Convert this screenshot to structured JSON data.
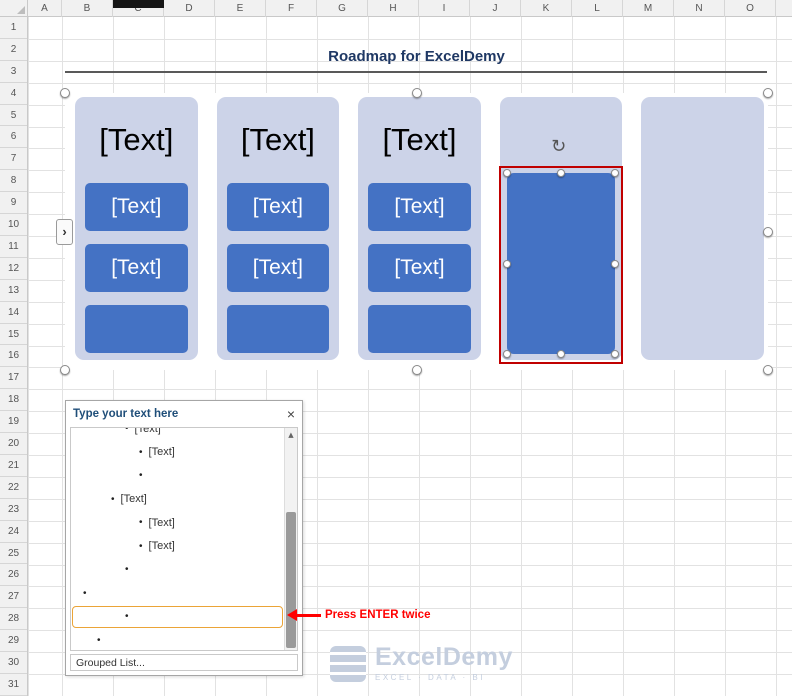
{
  "colors": {
    "accent_blue": "#4472C4",
    "column_fill": "#CCD3E8",
    "title_navy": "#1F3864",
    "pane_title_blue": "#1F4E79",
    "selection_red": "#C00000",
    "annotation_red": "#FF0000",
    "highlight_orange": "#EBA437",
    "watermark_gray_blue": "#C4CEDE"
  },
  "spreadsheet": {
    "column_headers": [
      "A",
      "B",
      "C",
      "D",
      "E",
      "F",
      "G",
      "H",
      "I",
      "J",
      "K",
      "L",
      "M",
      "N",
      "O"
    ],
    "row_numbers": [
      1,
      2,
      3,
      4,
      5,
      6,
      7,
      8,
      9,
      10,
      11,
      12,
      13,
      14,
      15,
      16,
      17,
      18,
      19,
      20,
      21,
      22,
      23,
      24,
      25,
      26,
      27,
      28,
      29,
      30,
      31
    ]
  },
  "title": {
    "text": "Roadmap for ExcelDemy"
  },
  "smartart": {
    "columns": [
      {
        "type": "list",
        "header": "[Text]",
        "boxes": [
          "[Text]",
          "[Text]",
          ""
        ]
      },
      {
        "type": "list",
        "header": "[Text]",
        "boxes": [
          "[Text]",
          "[Text]",
          ""
        ]
      },
      {
        "type": "list",
        "header": "[Text]",
        "boxes": [
          "[Text]",
          "[Text]",
          ""
        ]
      },
      {
        "type": "selected"
      },
      {
        "type": "empty"
      }
    ],
    "rotate_icon_glyph": "↻",
    "toggle_glyph": "›"
  },
  "text_pane": {
    "title": "Type your text here",
    "close_glyph": "×",
    "scroll_up_glyph": "▲",
    "bullet_glyph": "•",
    "items": [
      {
        "text": "[Text]",
        "level": 3,
        "partial": true
      },
      {
        "text": "[Text]",
        "level": 4
      },
      {
        "text": "",
        "level": 4
      },
      {
        "text": "[Text]",
        "level": 2
      },
      {
        "text": "[Text]",
        "level": 4
      },
      {
        "text": "[Text]",
        "level": 4
      },
      {
        "text": "",
        "level": 3
      },
      {
        "text": "",
        "level": 0
      },
      {
        "text": "",
        "level": 3,
        "highlighted": true
      },
      {
        "text": "",
        "level": 1
      }
    ],
    "footer": "Grouped List..."
  },
  "annotation": {
    "text": "Press ENTER twice"
  },
  "watermark": {
    "name": "ExcelDemy",
    "tagline": "EXCEL · DATA · BI"
  }
}
